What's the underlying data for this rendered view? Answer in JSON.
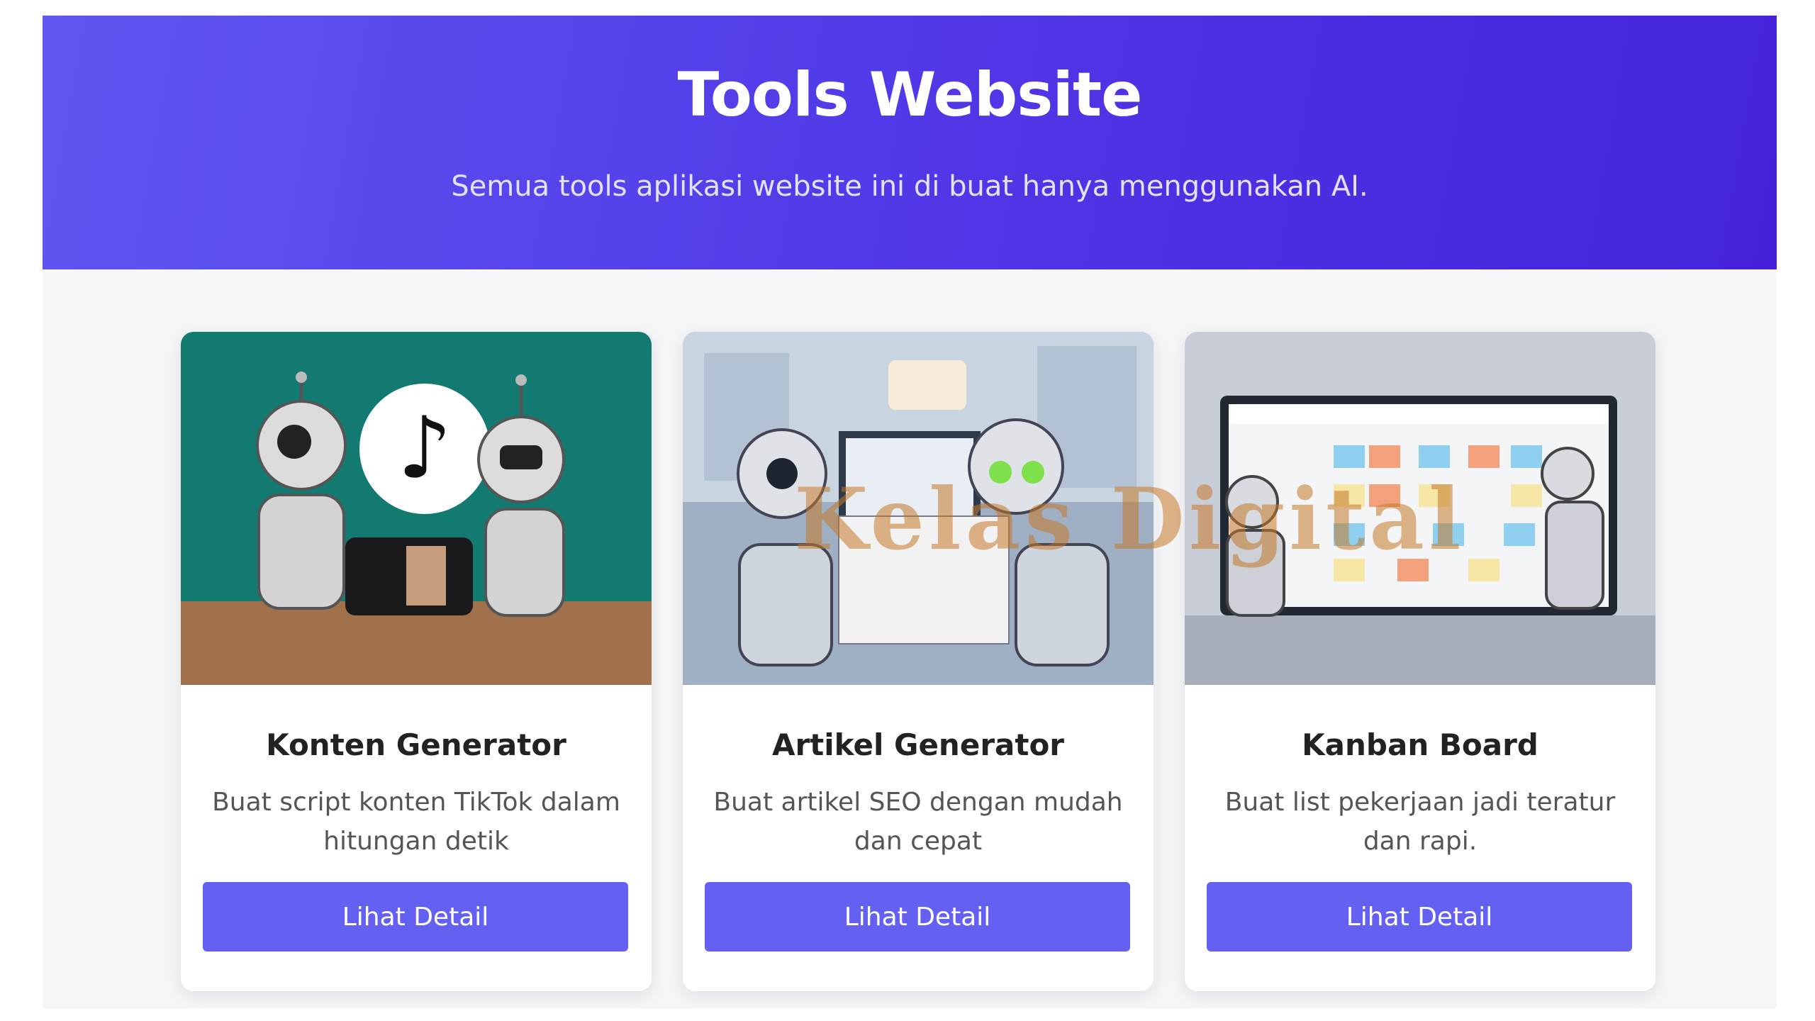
{
  "hero": {
    "title": "Tools Website",
    "subtitle": "Semua tools aplikasi website ini di buat hanya menggunakan AI."
  },
  "cards": [
    {
      "image": "robots-holding-phone-tiktok-illustration",
      "title": "Konten Generator",
      "description": "Buat script konten TikTok dalam hitungan detik",
      "button_label": "Lihat Detail"
    },
    {
      "image": "robots-writing-article-illustration",
      "title": "Artikel Generator",
      "description": "Buat artikel SEO dengan mudah dan cepat",
      "button_label": "Lihat Detail"
    },
    {
      "image": "robots-kanban-board-illustration",
      "title": "Kanban Board",
      "description": "Buat list pekerjaan jadi teratur dan rapi.",
      "button_label": "Lihat Detail"
    }
  ],
  "watermark": "Kelas Digital",
  "colors": {
    "hero_gradient_start": "#6056f1",
    "hero_gradient_end": "#4522d9",
    "button": "#6461f2",
    "page_background": "#f6f6f8"
  }
}
